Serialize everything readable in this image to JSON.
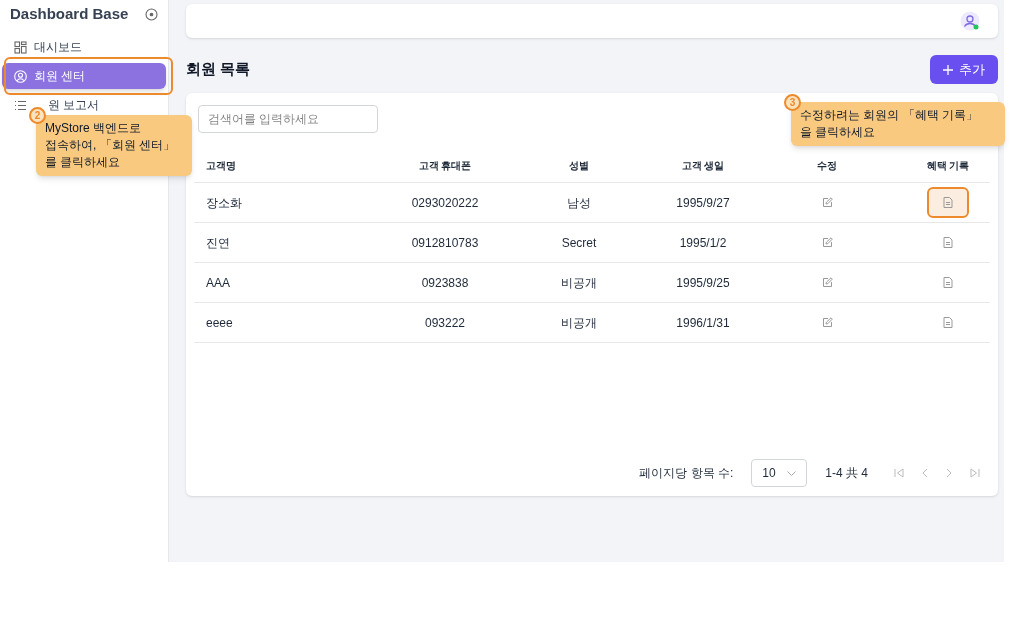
{
  "sidebar": {
    "title": "Dashboard Base",
    "items": [
      {
        "label": "대시보드",
        "selected": false,
        "highlighted": false
      },
      {
        "label": "회원 센터",
        "selected": true,
        "highlighted": true
      },
      {
        "label": "원 보고서",
        "selected": false,
        "highlighted": false
      }
    ]
  },
  "page": {
    "title": "회원 목록",
    "add_button": "추가"
  },
  "search": {
    "placeholder": "검색어를 입력하세요"
  },
  "table": {
    "columns": [
      "고객명",
      "고객 휴대폰",
      "성별",
      "고객 생일",
      "수정",
      "혜택 기록"
    ],
    "rows": [
      {
        "name": "장소화",
        "phone": "0293020222",
        "gender": "남성",
        "birthday": "1995/9/27",
        "highlighted": true
      },
      {
        "name": "진연",
        "phone": "0912810783",
        "gender": "Secret",
        "birthday": "1995/1/2",
        "highlighted": false
      },
      {
        "name": "AAA",
        "phone": "0923838",
        "gender": "비공개",
        "birthday": "1995/9/25",
        "highlighted": false
      },
      {
        "name": "eeee",
        "phone": "093222",
        "gender": "비공개",
        "birthday": "1996/1/31",
        "highlighted": false
      }
    ]
  },
  "pagination": {
    "label": "페이지당 항목 수:",
    "per_page": "10",
    "range": "1-4 共 4"
  },
  "callouts": [
    {
      "number": "2",
      "lines": [
        "MyStore 백엔드로",
        "접속하여, 「회원 센터」",
        "를 클릭하세요"
      ]
    },
    {
      "number": "3",
      "lines": [
        "수정하려는 회원의 「혜택 기록」",
        "을 클릭하세요"
      ]
    }
  ]
}
